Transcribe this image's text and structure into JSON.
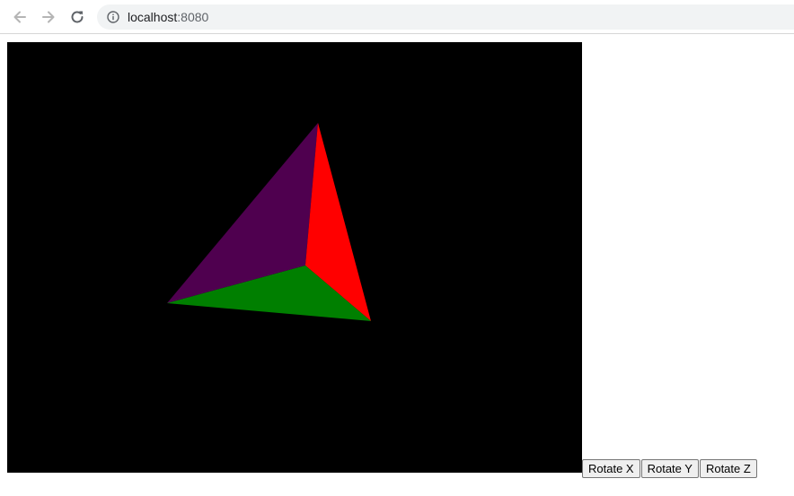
{
  "browser": {
    "url_host": "localhost",
    "url_port": ":8080"
  },
  "icons": {
    "back": "arrow-left-icon",
    "forward": "arrow-right-icon",
    "reload": "reload-icon",
    "info": "info-icon"
  },
  "scene": {
    "background": "#000000",
    "faces": [
      {
        "name": "left-face",
        "color": "#4f004f"
      },
      {
        "name": "right-face",
        "color": "#ff0000"
      },
      {
        "name": "bottom-face",
        "color": "#007f00"
      }
    ]
  },
  "controls": {
    "rotate_x": "Rotate X",
    "rotate_y": "Rotate Y",
    "rotate_z": "Rotate Z"
  }
}
